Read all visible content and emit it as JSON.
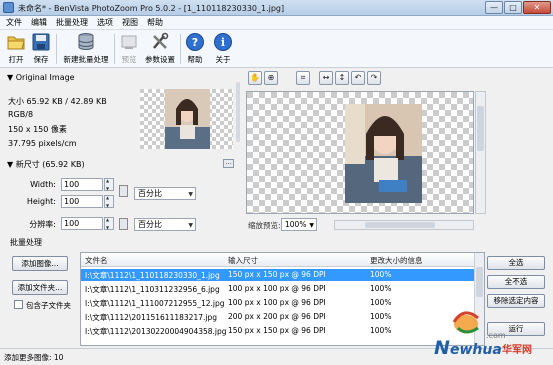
{
  "window": {
    "title": "未命名* - BenVista PhotoZoom Pro 5.0.2 - [1_110118230330_1.jpg]",
    "minimize": "—",
    "maximize": "□",
    "close": "✕"
  },
  "menu": [
    "文件",
    "编辑",
    "批量处理",
    "选项",
    "视图",
    "帮助"
  ],
  "toolbar": {
    "open": "打开",
    "save": "保存",
    "new_batch": "新建批量处理",
    "preview": "预览",
    "settings": "参数设置",
    "help": "帮助",
    "about": "关于"
  },
  "original_image": {
    "header": "▼ Original Image",
    "size": "大小 65.92 KB / 42.89 KB",
    "color": "RGB/8",
    "dimensions": "150 x 150 像素",
    "resolution": "37.795 pixels/cm"
  },
  "new_size": {
    "header": "▼ 新尺寸 (65.92 KB)",
    "more_button": "...",
    "width_label": "Width:",
    "width_value": "100",
    "height_label": "Height:",
    "height_value": "100",
    "resolution_label": "分辨率:",
    "resolution_value": "100",
    "unit_size": "百分比",
    "unit_resolution": "百分比"
  },
  "preview": {
    "zoom_label": "缩放预览:",
    "zoom_value": "100%"
  },
  "batch": {
    "label": "批量处理",
    "add_image": "添加图像...",
    "add_folder": "添加文件夹...",
    "include_subfolders": "包含子文件夹",
    "select_all": "全选",
    "deselect_all": "全不选",
    "remove_selected": "移除选定内容",
    "run": "运行"
  },
  "table": {
    "columns": [
      "文件名",
      "输入尺寸",
      "更改大小的信息"
    ],
    "rows": [
      [
        "I:\\文章\\1112\\1_110118230330_1.jpg",
        "150 px x 150 px @ 96 DPI",
        "100%"
      ],
      [
        "I:\\文章\\1112\\1_110311232956_6.jpg",
        "100 px x 100 px @ 96 DPI",
        "100%"
      ],
      [
        "I:\\文章\\1112\\1_111007212955_12.jpg",
        "100 px x 100 px @ 96 DPI",
        "100%"
      ],
      [
        "I:\\文章\\1112\\201151611183217.jpg",
        "200 px x 200 px @ 96 DPI",
        "100%"
      ],
      [
        "I:\\文章\\1112\\20130220004904358.jpg",
        "150 px x 150 px @ 96 DPI",
        "100%"
      ]
    ],
    "selected_row": 0
  },
  "status": {
    "text": "添加更多图像: 10"
  },
  "watermark": {
    "brand": "Newhua",
    "cn": "华军网",
    "domain": ".com"
  },
  "colors": {
    "selection": "#3399ff",
    "title_gradient_top": "#cfe0f1"
  }
}
